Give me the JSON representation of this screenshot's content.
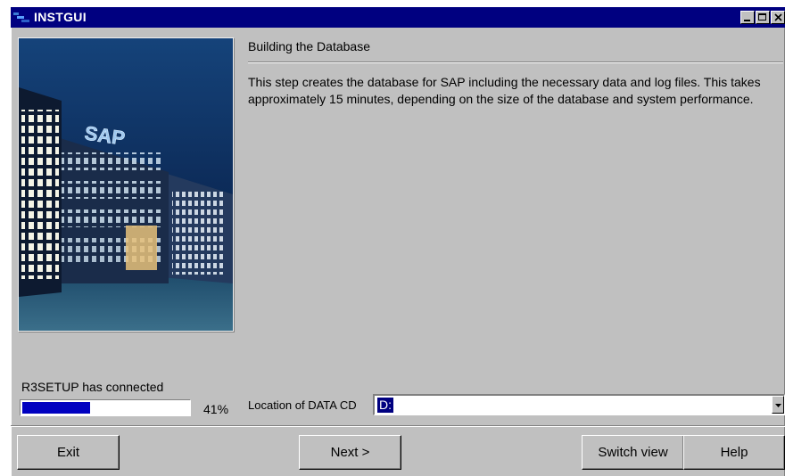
{
  "window": {
    "title": "INSTGUI",
    "controls": [
      "minimize-icon",
      "maximize-icon",
      "close-icon"
    ]
  },
  "image": {
    "sign_text": "SAP"
  },
  "step": {
    "title": "Building the Database",
    "description": "This step creates the database for SAP including the necessary data and log files. This takes approximately 15 minutes, depending on the size of the database and system performance."
  },
  "status": {
    "text": "R3SETUP has connected",
    "progress_percent": 41,
    "progress_label": "41%"
  },
  "location": {
    "label": "Location of DATA CD",
    "value": "D:"
  },
  "buttons": {
    "exit": "Exit",
    "next": "Next >",
    "switch_view": "Switch view",
    "help": "Help"
  },
  "colors": {
    "title_bar": "#000080",
    "face": "#c0c0c0",
    "progress_fill": "#0000c0"
  }
}
